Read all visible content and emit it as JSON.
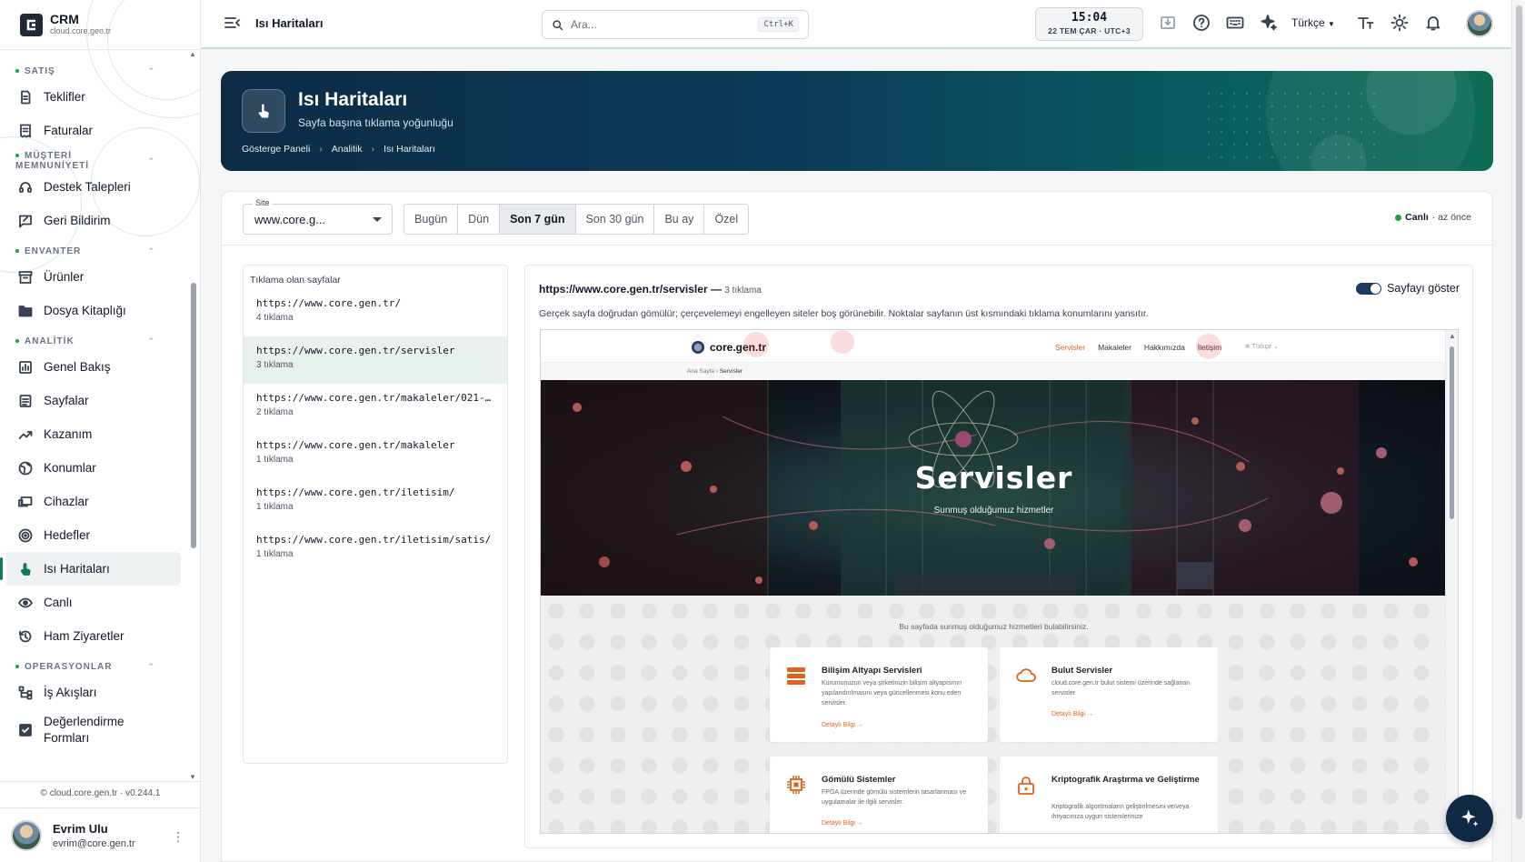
{
  "app": {
    "name": "CRM",
    "domain": "cloud.core.gen.tr"
  },
  "sidebar": {
    "sections": [
      {
        "title": "SATIŞ",
        "items": [
          "Teklifler",
          "Faturalar"
        ]
      },
      {
        "title": "MÜŞTERİ MEMNUNİYETİ",
        "items": [
          "Destek Talepleri",
          "Geri Bildirim"
        ]
      },
      {
        "title": "ENVANTER",
        "items": [
          "Ürünler",
          "Dosya Kitaplığı"
        ]
      },
      {
        "title": "ANALİTİK",
        "items": [
          "Genel Bakış",
          "Sayfalar",
          "Kazanım",
          "Konumlar",
          "Cihazlar",
          "Hedefler",
          "Isı Haritaları",
          "Canlı",
          "Ham Ziyaretler"
        ]
      },
      {
        "title": "OPERASYONLAR",
        "items": [
          "İş Akışları",
          "Değerlendirme Formları"
        ]
      }
    ],
    "active_item": "Isı Haritaları",
    "footer": "© cloud.core.gen.tr · v0.244.1",
    "user": {
      "name": "Evrim Ulu",
      "email": "evrim@core.gen.tr"
    }
  },
  "header": {
    "title": "Isı Haritaları",
    "search_placeholder": "Ara...",
    "search_shortcut": "Ctrl+K",
    "clock": {
      "time": "15:04",
      "date": "22 TEM ÇAR · UTC+3"
    },
    "language": "Türkçe",
    "icons": [
      "menu-collapse-icon",
      "install-icon",
      "help-icon",
      "keyboard-icon",
      "sparkle-icon",
      "text-size-icon",
      "theme-icon",
      "bell-icon"
    ]
  },
  "banner": {
    "title": "Isı Haritaları",
    "subtitle": "Sayfa başına tıklama yoğunluğu",
    "breadcrumb": [
      "Gösterge Paneli",
      "Analitik",
      "Isı Haritaları"
    ]
  },
  "filters": {
    "site_label": "Site",
    "site_value": "www.core.g...",
    "ranges": [
      "Bugün",
      "Dün",
      "Son 7 gün",
      "Son 30 gün",
      "Bu ay",
      "Özel"
    ],
    "active_range": "Son 7 gün",
    "live_label": "Canlı",
    "live_time": "· az önce"
  },
  "pages_panel": {
    "title": "Tıklama olan sayfalar",
    "items": [
      {
        "url": "https://www.core.gen.tr/",
        "count": "4 tıklama"
      },
      {
        "url": "https://www.core.gen.tr/servisler",
        "count": "3 tıklama"
      },
      {
        "url": "https://www.core.gen.tr/makaleler/021-…",
        "count": "2 tıklama"
      },
      {
        "url": "https://www.core.gen.tr/makaleler",
        "count": "1 tıklama"
      },
      {
        "url": "https://www.core.gen.tr/iletisim/",
        "count": "1 tıklama"
      },
      {
        "url": "https://www.core.gen.tr/iletisim/satis/",
        "count": "1 tıklama"
      }
    ],
    "selected_index": 1
  },
  "detail": {
    "url": "https://www.core.gen.tr/servisler",
    "sep": " — ",
    "count": "3 tıklama",
    "toggle_label": "Sayfayı göster",
    "toggle_on": true,
    "note": "Gerçek sayfa doğrudan gömülür; çerçevelemeyi engelleyen siteler boş görünebilir. Noktalar sayfanın üst kısmındaki tıklama konumlarını yansıtır."
  },
  "embedded": {
    "logo": "core.gen.tr",
    "menu": [
      "Servisler",
      "Makaleler",
      "Hakkımızda",
      "İletişim"
    ],
    "lang": "⊕ Türkçe ⌄",
    "breadcrumb_home": "Ana Sayfa",
    "breadcrumb_sep": "›",
    "breadcrumb_current": "Servisler",
    "hero_title": "Servisler",
    "hero_sub": "Sunmuş olduğumuz hizmetler",
    "intro": "Bu sayfada sunmuş olduğumuz hizmetleri bulabilirsiniz.",
    "services": [
      {
        "title": "Bilişim Altyapı Servisleri",
        "desc": "Kurumunuzun veya şirketinizin bilişim altyapısının yapılandırılmasını veya güncellenmesi konu eden servisler.",
        "link": "Detaylı Bilgi →"
      },
      {
        "title": "Bulut Servisler",
        "desc": "cloud.core.gen.tr bulut sistemi üzerinde sağlanan servisler",
        "link": "Detaylı Bilgi →"
      },
      {
        "title": "Gömülü Sistemler",
        "desc": "FPGA üzerinde gömülü sistemlerin tasarlanması ve uygulamalar ile ilgili servisler.",
        "link": "Detaylı Bilgi →"
      },
      {
        "title": "Kriptografik Araştırma ve Geliştirme",
        "desc": "Kriptografik algoritmaların geliştirilmesini ve/veya ihtiyacınıza uygun sistemlerinize",
        "link": ""
      }
    ]
  },
  "colors": {
    "accent": "#0f7a5f",
    "banner_dark": "#0d2b45",
    "banner_green": "#0d6d54",
    "embedded_accent": "#e0621b",
    "click_dot": "#ef4444"
  }
}
